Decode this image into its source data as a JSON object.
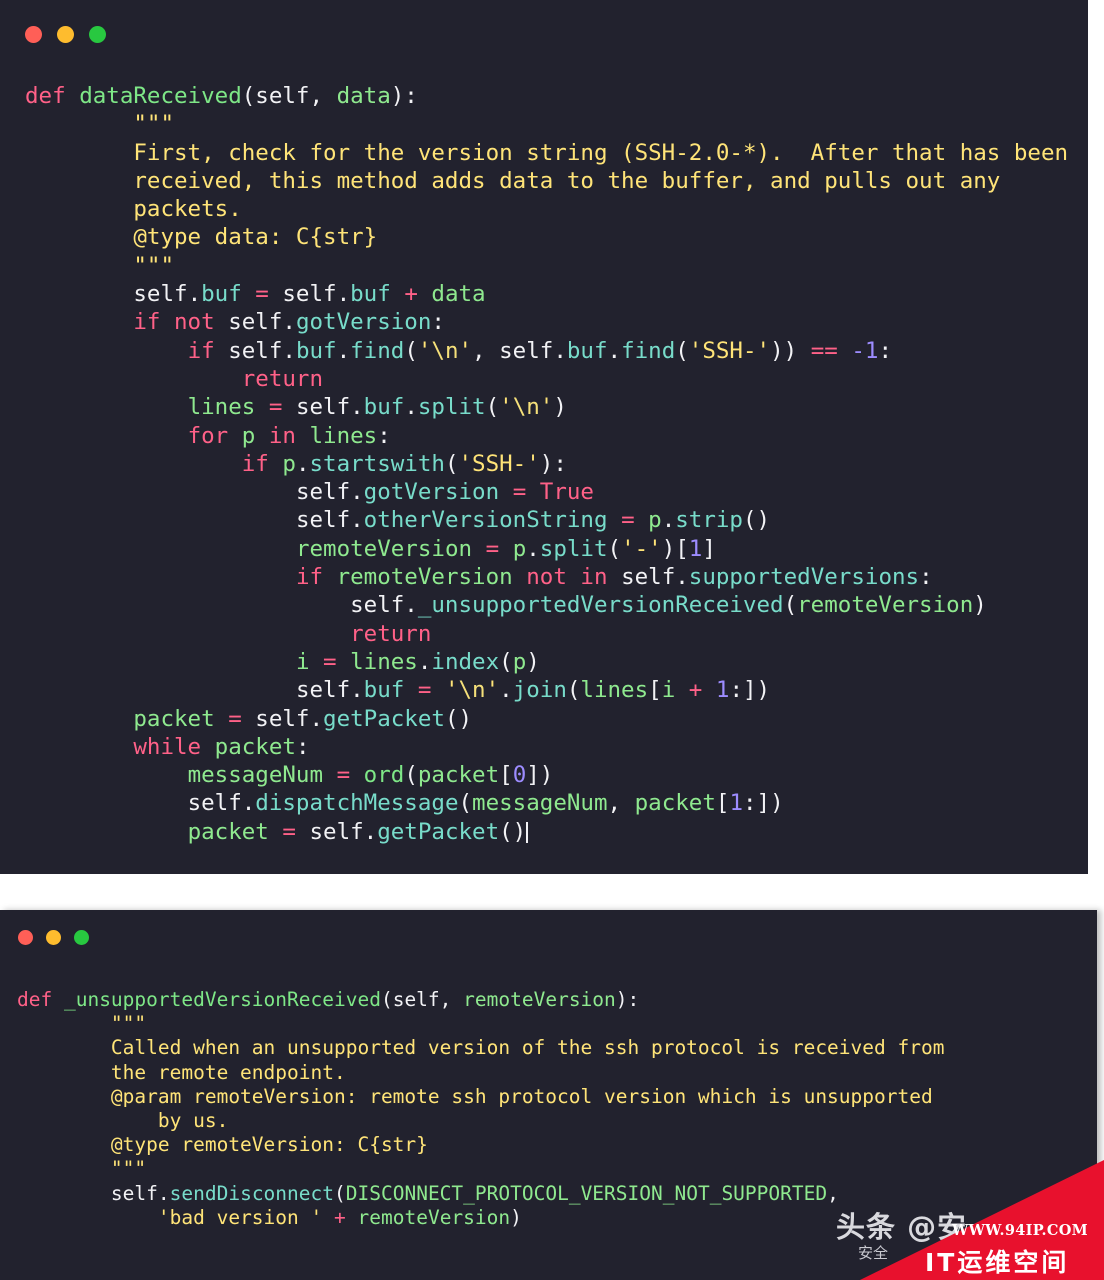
{
  "windows": [
    {
      "name": "dataReceived-window",
      "traffic_lights": [
        {
          "name": "close-button",
          "color": "#ff5f57"
        },
        {
          "name": "minimize-button",
          "color": "#febc2e"
        },
        {
          "name": "maximize-button",
          "color": "#28c840"
        }
      ],
      "background": "#22222e",
      "code_lines": [
        "def dataReceived(self, data):",
        "        \"\"\"",
        "        First, check for the version string (SSH-2.0-*).  After that has been",
        "        received, this method adds data to the buffer, and pulls out any",
        "        packets.",
        "        @type data: C{str}",
        "        \"\"\"",
        "        self.buf = self.buf + data",
        "        if not self.gotVersion:",
        "            if self.buf.find('\\n', self.buf.find('SSH-')) == -1:",
        "                return",
        "            lines = self.buf.split('\\n')",
        "            for p in lines:",
        "                if p.startswith('SSH-'):",
        "                    self.gotVersion = True",
        "                    self.otherVersionString = p.strip()",
        "                    remoteVersion = p.split('-')[1]",
        "                    if remoteVersion not in self.supportedVersions:",
        "                        self._unsupportedVersionReceived(remoteVersion)",
        "                        return",
        "                    i = lines.index(p)",
        "                    self.buf = '\\n'.join(lines[i + 1:])",
        "        packet = self.getPacket()",
        "        while packet:",
        "            messageNum = ord(packet[0])",
        "            self.dispatchMessage(messageNum, packet[1:])",
        "            packet = self.getPacket()"
      ]
    },
    {
      "name": "unsupportedVersionReceived-window",
      "traffic_lights": [
        {
          "name": "close-button",
          "color": "#ff5f57"
        },
        {
          "name": "minimize-button",
          "color": "#febc2e"
        },
        {
          "name": "maximize-button",
          "color": "#28c840"
        }
      ],
      "background": "#22222e",
      "code_lines": [
        "def _unsupportedVersionReceived(self, remoteVersion):",
        "        \"\"\"",
        "        Called when an unsupported version of the ssh protocol is received from",
        "        the remote endpoint.",
        "        @param remoteVersion: remote ssh protocol version which is unsupported",
        "            by us.",
        "        @type remoteVersion: C{str}",
        "        \"\"\"",
        "        self.sendDisconnect(DISCONNECT_PROTOCOL_VERSION_NOT_SUPPORTED,",
        "            'bad version ' + remoteVersion)"
      ]
    }
  ],
  "watermarks": {
    "toutiao": {
      "main": "头条 @安",
      "sub": "安全"
    },
    "banner": {
      "url": "WWW.94IP.COM",
      "title": "IT运维空间",
      "color": "#e8112d"
    }
  },
  "syntax_colors": {
    "keyword": "#ff6188",
    "function": "#7ee787",
    "attribute": "#78dcca",
    "string": "#ffe478",
    "number": "#9d8cff",
    "text": "#f2f2f5",
    "background": "#22222e"
  }
}
